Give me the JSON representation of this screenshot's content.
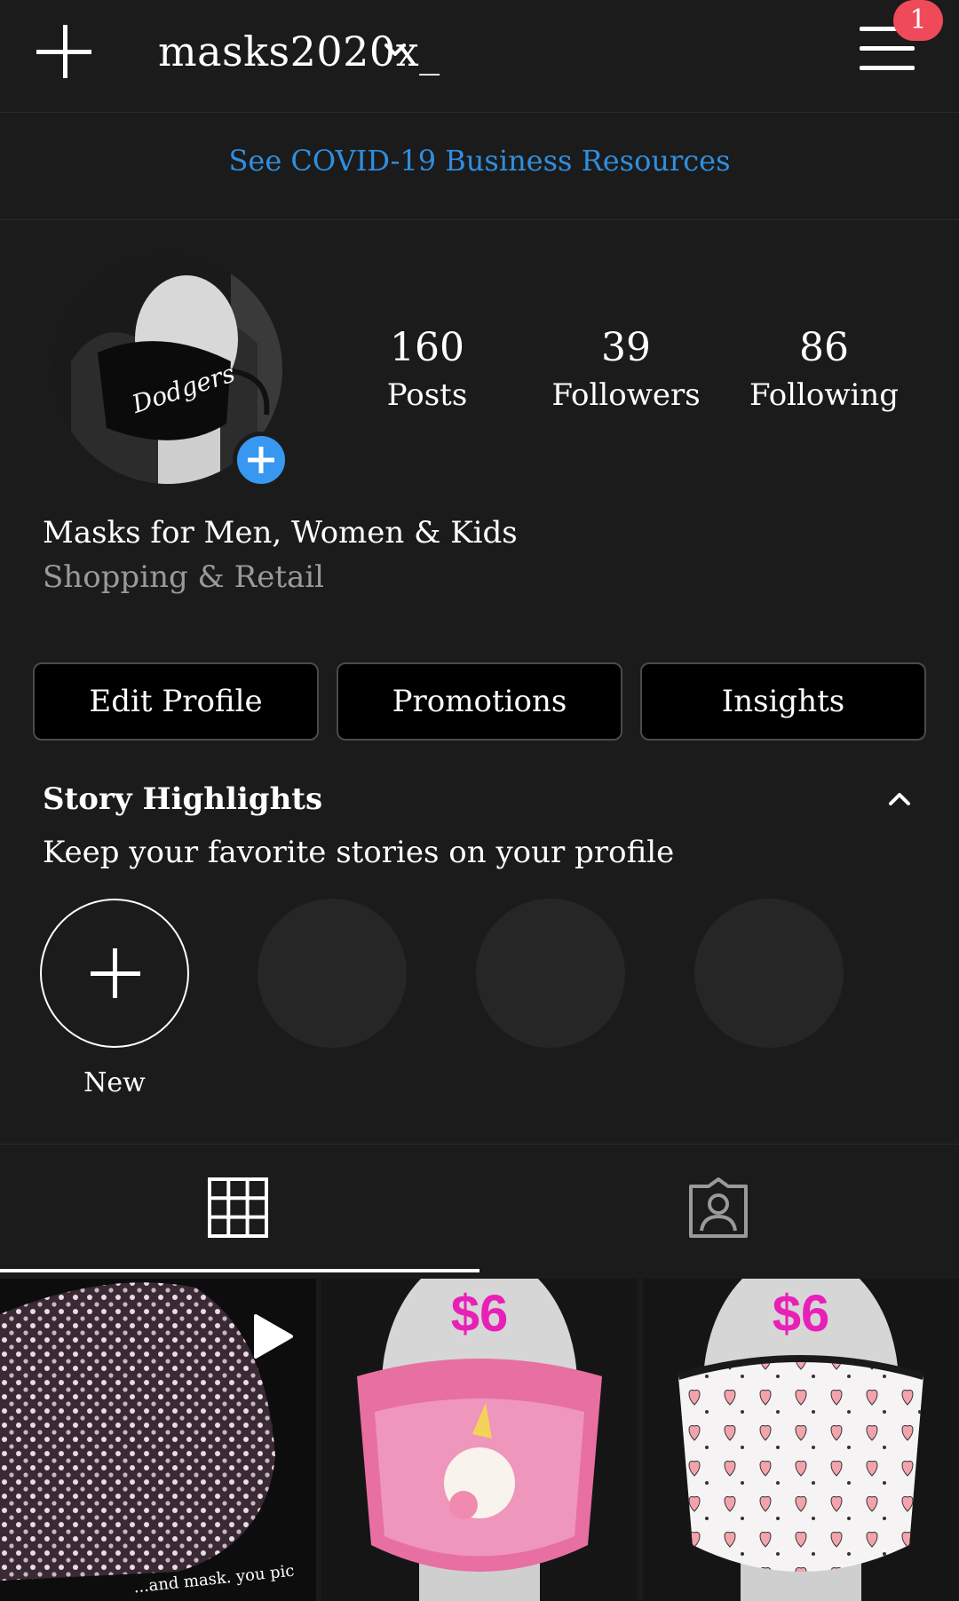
{
  "header": {
    "username": "masks2020x_",
    "notification_count": "1"
  },
  "banner": {
    "covid_link": "See COVID-19 Business Resources"
  },
  "profile": {
    "stats": [
      {
        "value": "160",
        "label": "Posts"
      },
      {
        "value": "39",
        "label": "Followers"
      },
      {
        "value": "86",
        "label": "Following"
      }
    ],
    "name": "Masks for Men, Women & Kids",
    "category": "Shopping & Retail",
    "avatar_mask_text": "Dodgers"
  },
  "actions": {
    "edit_profile": "Edit Profile",
    "promotions": "Promotions",
    "insights": "Insights"
  },
  "highlights": {
    "title": "Story Highlights",
    "subtitle": "Keep your favorite stories on your profile",
    "new_label": "New"
  },
  "posts": [
    {
      "overlay_text": "...and mask. you pic",
      "is_video": true
    },
    {
      "price": "$6"
    },
    {
      "price": "$6"
    }
  ],
  "colors": {
    "background": "#1b1b1b",
    "link_blue": "#2f8fe0",
    "badge_red": "#ef4a5a",
    "avatar_plus_blue": "#3897f0",
    "price_magenta": "#e820b8"
  }
}
